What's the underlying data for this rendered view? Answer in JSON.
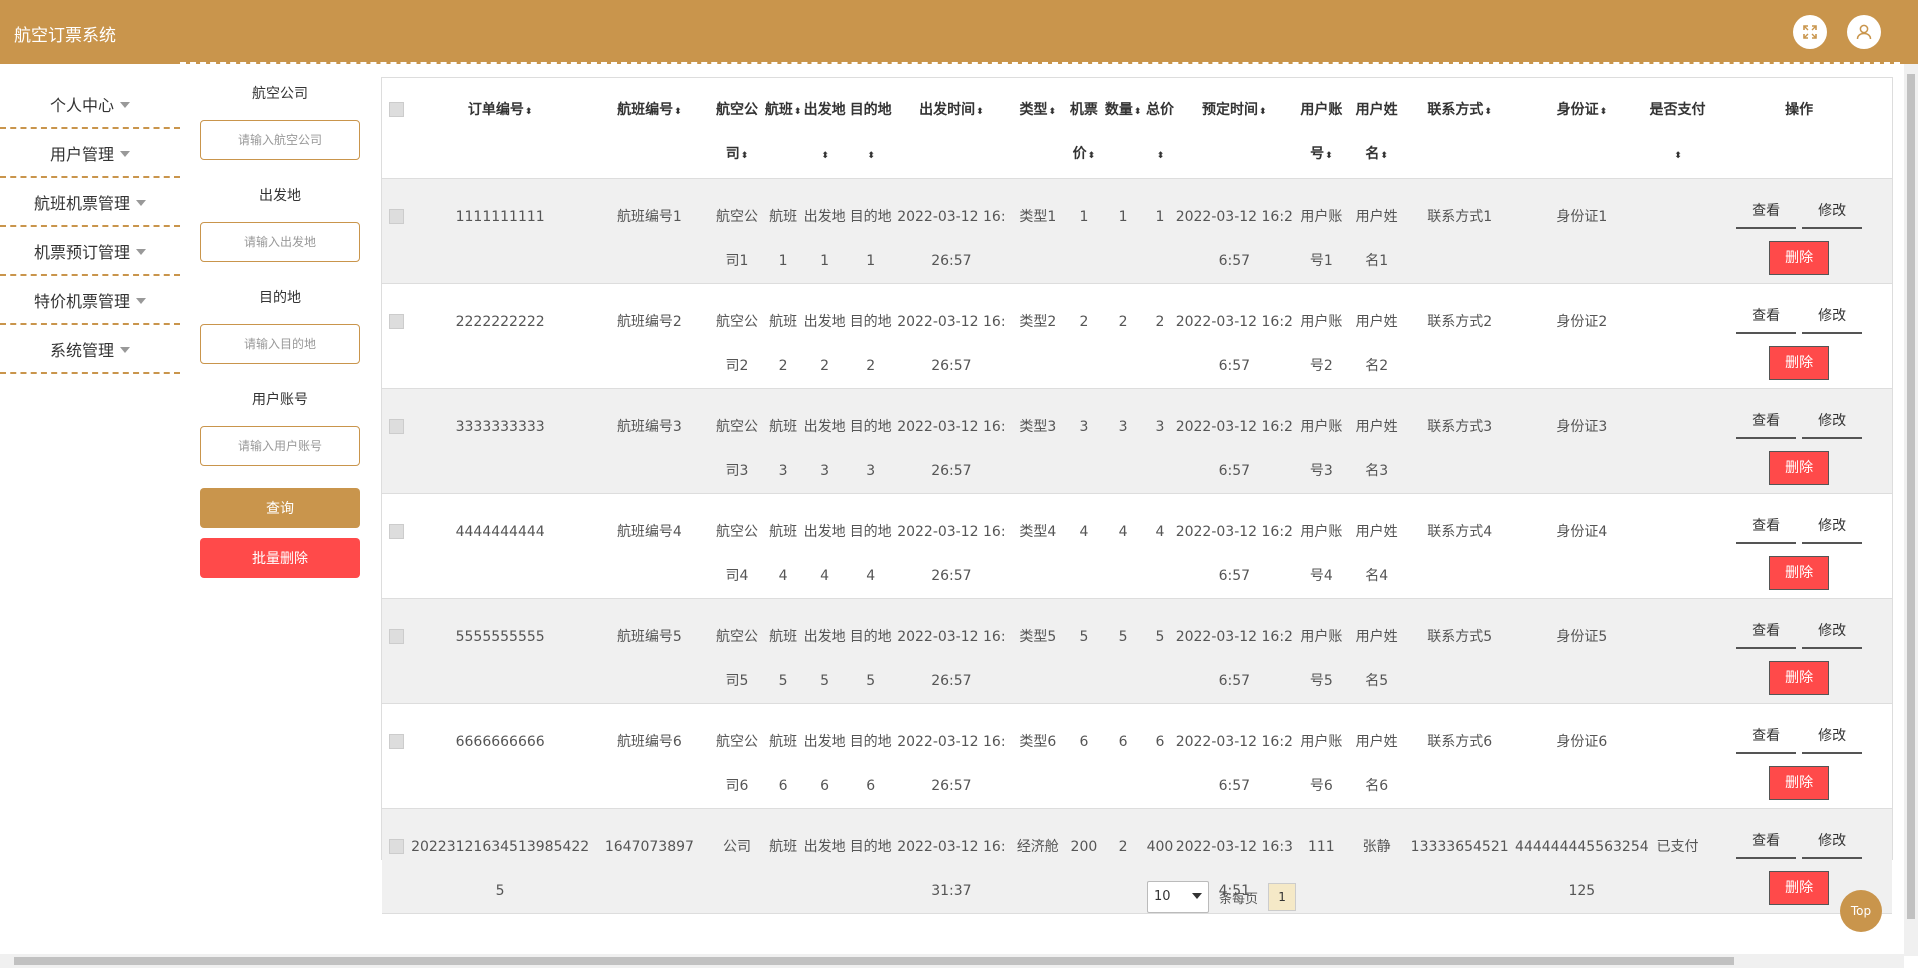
{
  "header": {
    "title": "航空订票系统",
    "fullscreen_icon": "expand-icon",
    "user_icon": "user-icon"
  },
  "sidebar": {
    "items": [
      {
        "label": "个人中心"
      },
      {
        "label": "用户管理"
      },
      {
        "label": "航班机票管理"
      },
      {
        "label": "机票预订管理"
      },
      {
        "label": "特价机票管理"
      },
      {
        "label": "系统管理"
      }
    ]
  },
  "search": {
    "airline_label": "航空公司",
    "airline_placeholder": "请输入航空公司",
    "origin_label": "出发地",
    "origin_placeholder": "请输入出发地",
    "dest_label": "目的地",
    "dest_placeholder": "请输入目的地",
    "account_label": "用户账号",
    "account_placeholder": "请输入用户账号",
    "query_label": "查询",
    "bulk_delete_label": "批量删除"
  },
  "table": {
    "columns": [
      "订单编号",
      "航班编号",
      "航空公司",
      "航班",
      "出发地",
      "目的地",
      "出发时间",
      "类型",
      "机票价",
      "数量",
      "总价",
      "预定时间",
      "用户账号",
      "用户姓名",
      "联系方式",
      "身份证",
      "是否支付",
      "操作"
    ],
    "rows": [
      {
        "order": "1111111111",
        "flight_no": "航班编号1",
        "airline": "航空公司1",
        "flight": "航班1",
        "origin": "出发地1",
        "dest": "目的地1",
        "depart": "2022-03-12 16:26:57",
        "type": "类型1",
        "price": "1",
        "qty": "1",
        "total": "1",
        "booked": "2022-03-12 16:26:57",
        "account": "用户账号1",
        "name": "用户姓名1",
        "contact": "联系方式1",
        "id_card": "身份证1",
        "paid": ""
      },
      {
        "order": "2222222222",
        "flight_no": "航班编号2",
        "airline": "航空公司2",
        "flight": "航班2",
        "origin": "出发地2",
        "dest": "目的地2",
        "depart": "2022-03-12 16:26:57",
        "type": "类型2",
        "price": "2",
        "qty": "2",
        "total": "2",
        "booked": "2022-03-12 16:26:57",
        "account": "用户账号2",
        "name": "用户姓名2",
        "contact": "联系方式2",
        "id_card": "身份证2",
        "paid": ""
      },
      {
        "order": "3333333333",
        "flight_no": "航班编号3",
        "airline": "航空公司3",
        "flight": "航班3",
        "origin": "出发地3",
        "dest": "目的地3",
        "depart": "2022-03-12 16:26:57",
        "type": "类型3",
        "price": "3",
        "qty": "3",
        "total": "3",
        "booked": "2022-03-12 16:26:57",
        "account": "用户账号3",
        "name": "用户姓名3",
        "contact": "联系方式3",
        "id_card": "身份证3",
        "paid": ""
      },
      {
        "order": "4444444444",
        "flight_no": "航班编号4",
        "airline": "航空公司4",
        "flight": "航班4",
        "origin": "出发地4",
        "dest": "目的地4",
        "depart": "2022-03-12 16:26:57",
        "type": "类型4",
        "price": "4",
        "qty": "4",
        "total": "4",
        "booked": "2022-03-12 16:26:57",
        "account": "用户账号4",
        "name": "用户姓名4",
        "contact": "联系方式4",
        "id_card": "身份证4",
        "paid": ""
      },
      {
        "order": "5555555555",
        "flight_no": "航班编号5",
        "airline": "航空公司5",
        "flight": "航班5",
        "origin": "出发地5",
        "dest": "目的地5",
        "depart": "2022-03-12 16:26:57",
        "type": "类型5",
        "price": "5",
        "qty": "5",
        "total": "5",
        "booked": "2022-03-12 16:26:57",
        "account": "用户账号5",
        "name": "用户姓名5",
        "contact": "联系方式5",
        "id_card": "身份证5",
        "paid": ""
      },
      {
        "order": "6666666666",
        "flight_no": "航班编号6",
        "airline": "航空公司6",
        "flight": "航班6",
        "origin": "出发地6",
        "dest": "目的地6",
        "depart": "2022-03-12 16:26:57",
        "type": "类型6",
        "price": "6",
        "qty": "6",
        "total": "6",
        "booked": "2022-03-12 16:26:57",
        "account": "用户账号6",
        "name": "用户姓名6",
        "contact": "联系方式6",
        "id_card": "身份证6",
        "paid": ""
      },
      {
        "order": "20223121634513985422 5",
        "flight_no": "1647073897",
        "airline": "公司",
        "flight": "航班",
        "origin": "出发地",
        "dest": "目的地",
        "depart": "2022-03-12 16:31:37",
        "type": "经济舱",
        "price": "200",
        "qty": "2",
        "total": "400",
        "booked": "2022-03-12 16:34:51",
        "account": "111",
        "name": "张静",
        "contact": "13333654521",
        "id_card": "444444445563254125",
        "paid": "已支付"
      }
    ],
    "actions": {
      "view": "查看",
      "edit": "修改",
      "delete": "删除"
    }
  },
  "pagination": {
    "page_size": "10",
    "per_page_label": "条每页",
    "current_page": "1"
  },
  "back_to_top": "Top",
  "colors": {
    "brand": "#c9954c",
    "danger": "#ff4a4a"
  }
}
